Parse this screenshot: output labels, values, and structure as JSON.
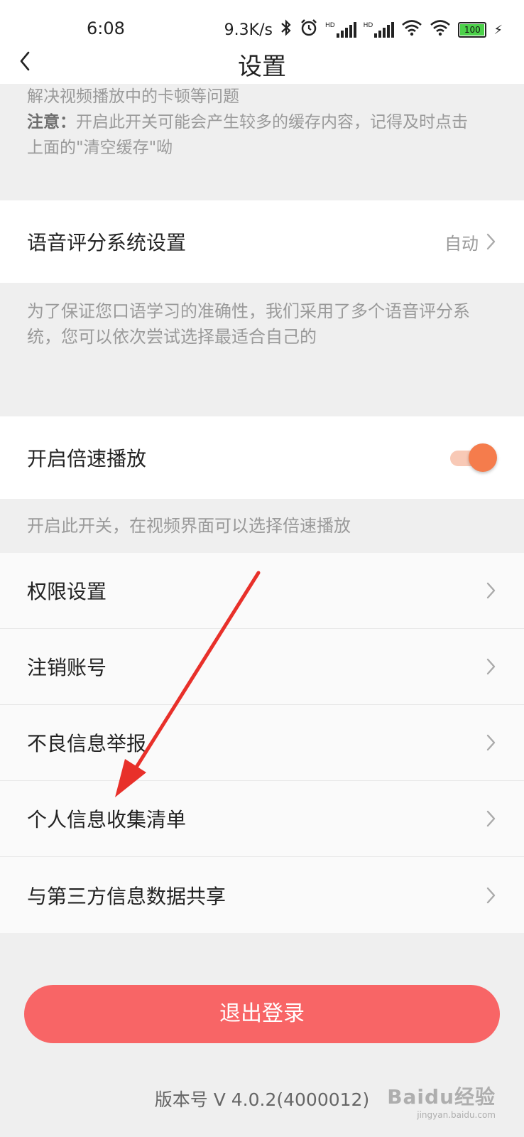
{
  "status_bar": {
    "time": "6:08",
    "network_speed": "9.3K/s",
    "hd1": "HD",
    "hd2": "HD",
    "battery": "100",
    "icons": [
      "bluetooth-icon",
      "alarm-icon",
      "signal-icon",
      "wifi-icon",
      "battery-icon",
      "charging-icon"
    ]
  },
  "header": {
    "title": "设置"
  },
  "cache_note": {
    "line1": "解决视频播放中的卡顿等问题",
    "note_label": "注意：",
    "line2": "开启此开关可能会产生较多的缓存内容，记得及时点击",
    "line3": "上面的\"清空缓存\"呦"
  },
  "voice_setting": {
    "label": "语音评分系统设置",
    "value": "自动",
    "desc_line1": "为了保证您口语学习的准确性，我们采用了多个语音评分系",
    "desc_line2": "统，您可以依次尝试选择最适合自己的"
  },
  "speed_play": {
    "label": "开启倍速播放",
    "enabled": true,
    "desc": "开启此开关，在视频界面可以选择倍速播放"
  },
  "menu": [
    {
      "label": "权限设置"
    },
    {
      "label": "注销账号"
    },
    {
      "label": "不良信息举报"
    },
    {
      "label": "个人信息收集清单"
    },
    {
      "label": "与第三方信息数据共享"
    }
  ],
  "logout": {
    "label": "退出登录"
  },
  "version": {
    "text": "版本号 V 4.0.2(4000012)"
  },
  "watermark": {
    "main": "Baidu经验",
    "sub": "jingyan.baidu.com"
  },
  "colors": {
    "accent_orange": "#f57c4c",
    "logout_red": "#f86566",
    "background": "#efefef",
    "annotation_arrow": "#e8302a"
  }
}
